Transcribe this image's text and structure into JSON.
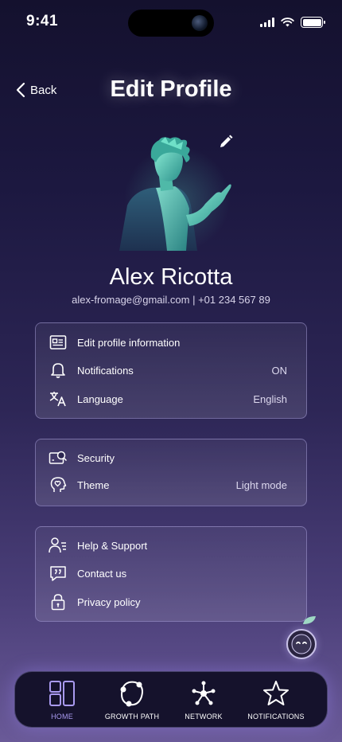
{
  "status_bar": {
    "time": "9:41"
  },
  "header": {
    "back_label": "Back",
    "title": "Edit Profile"
  },
  "profile": {
    "name": "Alex Ricotta",
    "contact": "alex-fromage@gmail.com | +01 234 567 89"
  },
  "groups": [
    {
      "items": [
        {
          "label": "Edit profile information",
          "value": "",
          "icon": "id-card-icon"
        },
        {
          "label": "Notifications",
          "value": "ON",
          "icon": "bell-icon"
        },
        {
          "label": "Language",
          "value": "English",
          "icon": "translate-icon"
        }
      ]
    },
    {
      "items": [
        {
          "label": "Security",
          "value": "",
          "icon": "security-icon"
        },
        {
          "label": "Theme",
          "value": "Light mode",
          "icon": "theme-icon"
        }
      ]
    },
    {
      "items": [
        {
          "label": "Help & Support",
          "value": "",
          "icon": "help-icon"
        },
        {
          "label": "Contact us",
          "value": "",
          "icon": "chat-quote-icon"
        },
        {
          "label": "Privacy policy",
          "value": "",
          "icon": "lock-icon"
        }
      ]
    }
  ],
  "tabbar": {
    "tabs": [
      {
        "label": "HOME",
        "icon": "home-grid-icon",
        "active": true
      },
      {
        "label": "GROWTH PATH",
        "icon": "growth-path-icon",
        "active": false
      },
      {
        "label": "NETWORK",
        "icon": "network-icon",
        "active": false
      },
      {
        "label": "NOTIFICATIONS",
        "icon": "star-icon",
        "active": false
      }
    ]
  },
  "colors": {
    "accent": "#a99af0",
    "avatar_teal": "#5fdcc0",
    "background_top": "#14112e",
    "background_bottom": "#6a5a98"
  }
}
